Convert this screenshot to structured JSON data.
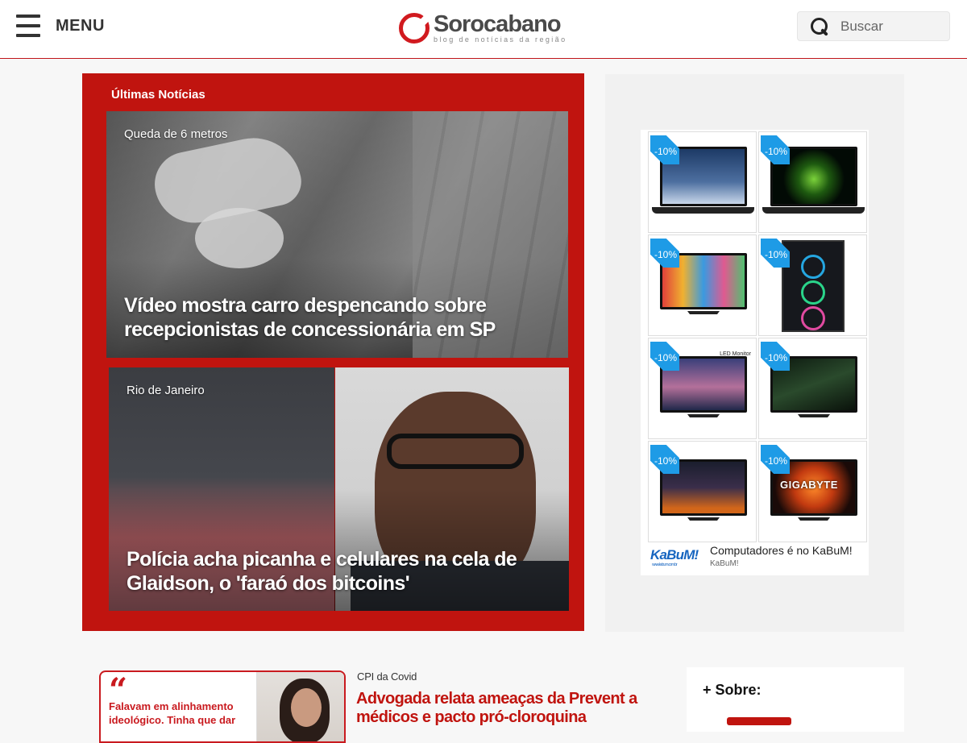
{
  "header": {
    "menu_label": "MENU",
    "logo_name": "Sorocabano",
    "logo_tagline": "blog de notícias da região",
    "search_placeholder": "Buscar"
  },
  "latest": {
    "title": "Últimas Notícias",
    "cards": [
      {
        "category": "Queda de 6 metros",
        "headline": "Vídeo mostra carro despencando sobre recepcionistas de concessionária em SP"
      },
      {
        "category": "Rio de Janeiro",
        "headline": "Polícia acha picanha e celulares na cela de Glaidson, o 'faraó dos bitcoins'"
      }
    ]
  },
  "ad": {
    "discount": "-10%",
    "footer_text": "Computadores é no KaBuM!",
    "footer_sub": "KaBuM!",
    "brand_logo": "KaBuM!",
    "brand_url": "www.kabum.com.br",
    "gigabyte_text": "GIGABYTE",
    "led_text": "LED Monitor"
  },
  "bottom": {
    "quote_text": "Falavam em alinhamento ideológico. Tinha que dar",
    "category": "CPI da Covid",
    "headline": "Advogada relata ameaças da Prevent a médicos e pacto pró-cloroquina"
  },
  "sidebar": {
    "about_title": "+ Sobre:"
  },
  "colors": {
    "brand_red": "#c0140f",
    "badge_blue": "#1e9be6"
  }
}
